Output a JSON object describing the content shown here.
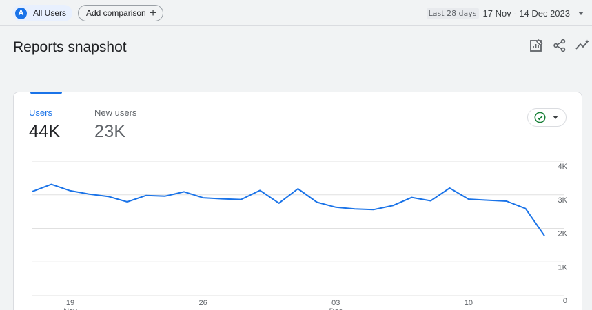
{
  "filters": {
    "comparison_avatar": "A",
    "comparison_label": "All Users",
    "add_comparison_label": "Add comparison",
    "add_comparison_icon": "plus-icon"
  },
  "date_range": {
    "period": "Last 28 days",
    "dates": "17 Nov - 14 Dec 2023"
  },
  "page": {
    "title": "Reports snapshot",
    "actions": [
      "customize-report-icon",
      "share-icon",
      "insights-icon"
    ]
  },
  "card": {
    "metrics": [
      {
        "label": "Users",
        "value": "44K",
        "active": true
      },
      {
        "label": "New users",
        "value": "23K",
        "active": false
      }
    ],
    "insight_icon": "check-circle-icon"
  },
  "colors": {
    "accent": "#1a73e8",
    "line": "#1a73e8",
    "grid": "#e0e0e0",
    "check": "#188038"
  },
  "chart_data": {
    "type": "line",
    "x": [
      "17 Nov",
      "18 Nov",
      "19 Nov",
      "20 Nov",
      "21 Nov",
      "22 Nov",
      "23 Nov",
      "24 Nov",
      "25 Nov",
      "26 Nov",
      "27 Nov",
      "28 Nov",
      "29 Nov",
      "30 Nov",
      "01 Dec",
      "02 Dec",
      "03 Dec",
      "04 Dec",
      "05 Dec",
      "06 Dec",
      "07 Dec",
      "08 Dec",
      "09 Dec",
      "10 Dec",
      "11 Dec",
      "12 Dec",
      "13 Dec",
      "14 Dec"
    ],
    "series": [
      {
        "values": [
          3100,
          3310,
          3120,
          3020,
          2950,
          2790,
          2980,
          2960,
          3090,
          2910,
          2880,
          2860,
          3130,
          2750,
          3180,
          2780,
          2630,
          2580,
          2560,
          2680,
          2920,
          2820,
          3200,
          2870,
          2840,
          2810,
          2590,
          1780
        ]
      }
    ],
    "x_tick_labels": [
      "19",
      "26",
      "03",
      "10"
    ],
    "x_tick_sublabels": [
      "Nov",
      "",
      "Dec",
      ""
    ],
    "y_ticks": [
      "4K",
      "3K",
      "2K",
      "1K",
      "0"
    ],
    "ylim": [
      0,
      4000
    ],
    "grid": true,
    "legend": "none"
  }
}
